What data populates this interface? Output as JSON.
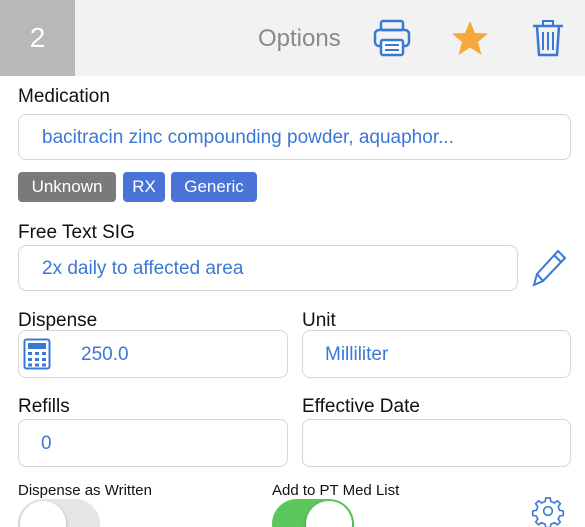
{
  "header": {
    "count": "2",
    "title": "Options",
    "accent_color": "#3a78d8",
    "star_color": "#f4a93a",
    "icons": [
      "printer-icon",
      "star-icon",
      "trash-icon"
    ]
  },
  "medication": {
    "label": "Medication",
    "value": "bacitracin zinc compounding powder, aquaphor..."
  },
  "badges": [
    "Unknown",
    "RX",
    "Generic"
  ],
  "sig": {
    "label": "Free Text SIG",
    "value": "2x daily to affected area",
    "edit_icon": "pencil-icon"
  },
  "dispense": {
    "label": "Dispense",
    "value": "250.0",
    "icon": "calculator-icon"
  },
  "unit": {
    "label": "Unit",
    "value": "Milliliter"
  },
  "refills": {
    "label": "Refills",
    "value": "0"
  },
  "effective_date": {
    "label": "Effective Date",
    "value": ""
  },
  "toggles": {
    "daw": {
      "label": "Dispense as Written",
      "on": false
    },
    "pt_list": {
      "label": "Add to PT Med List",
      "on": true,
      "on_color": "#5cc85c"
    }
  },
  "settings_icon": "gear-icon"
}
